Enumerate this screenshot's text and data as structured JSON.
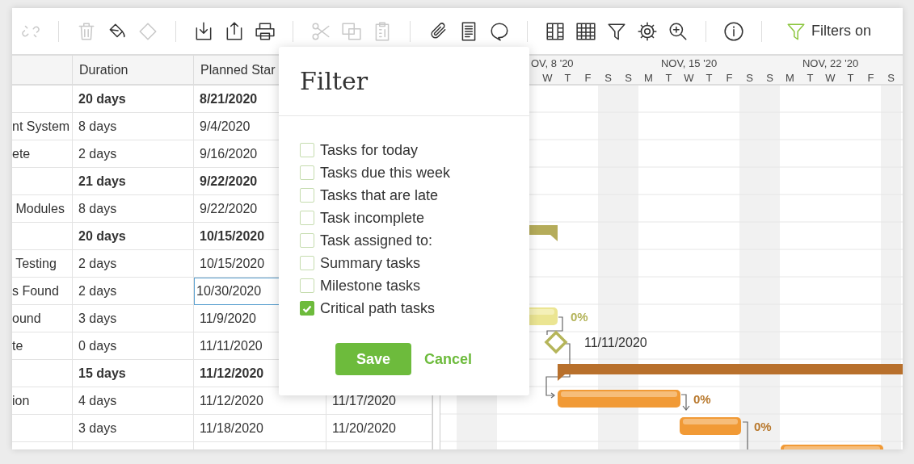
{
  "toolbar": {
    "groups": [
      {
        "items": [
          {
            "kind": "unlink",
            "disabled": true
          }
        ]
      },
      {
        "items": [
          {
            "kind": "trash",
            "disabled": true
          },
          {
            "kind": "paint-bucket",
            "disabled": false
          },
          {
            "kind": "diamond",
            "disabled": true
          }
        ]
      },
      {
        "items": [
          {
            "kind": "download",
            "disabled": false
          },
          {
            "kind": "upload",
            "disabled": false
          },
          {
            "kind": "print",
            "disabled": false
          }
        ]
      },
      {
        "items": [
          {
            "kind": "scissors",
            "disabled": true
          },
          {
            "kind": "copy",
            "disabled": true
          },
          {
            "kind": "clipboard",
            "disabled": true
          }
        ]
      },
      {
        "items": [
          {
            "kind": "paperclip",
            "disabled": false
          },
          {
            "kind": "document",
            "disabled": false
          },
          {
            "kind": "comment",
            "disabled": false
          }
        ]
      },
      {
        "items": [
          {
            "kind": "columns",
            "disabled": false
          },
          {
            "kind": "grid",
            "disabled": false
          },
          {
            "kind": "filter",
            "disabled": false
          },
          {
            "kind": "gear",
            "disabled": false
          },
          {
            "kind": "zoom-in",
            "disabled": false
          }
        ]
      },
      {
        "items": [
          {
            "kind": "info",
            "disabled": false
          }
        ]
      }
    ],
    "filter_status": {
      "label": "Filters on",
      "active": true
    }
  },
  "table": {
    "columns": [
      "Duration",
      "Planned Star"
    ],
    "rows": [
      {
        "name": "",
        "duration": "20 days",
        "start": "8/21/2020",
        "summary": true,
        "start_selected": false
      },
      {
        "name": "nt System",
        "duration": "8 days",
        "start": "9/4/2020",
        "summary": false,
        "start_selected": false
      },
      {
        "name": "ete",
        "duration": "2 days",
        "start": "9/16/2020",
        "summary": false,
        "start_selected": false
      },
      {
        "name": "",
        "duration": "21 days",
        "start": "9/22/2020",
        "summary": true,
        "start_selected": false
      },
      {
        "name": " Modules",
        "duration": "8 days",
        "start": "9/22/2020",
        "summary": false,
        "start_selected": false
      },
      {
        "name": "",
        "duration": "20 days",
        "start": "10/15/2020",
        "summary": true,
        "start_selected": false
      },
      {
        "name": " Testing",
        "duration": "2 days",
        "start": "10/15/2020",
        "summary": false,
        "start_selected": false
      },
      {
        "name": "s Found",
        "duration": "2 days",
        "start": "10/30/2020",
        "summary": false,
        "start_selected": true
      },
      {
        "name": "ound",
        "duration": "3 days",
        "start": "11/9/2020",
        "summary": false,
        "start_selected": false
      },
      {
        "name": "te",
        "duration": "0 days",
        "start": "11/11/2020",
        "summary": false,
        "start_selected": false
      },
      {
        "name": "",
        "duration": "15 days",
        "start": "11/12/2020",
        "summary": true,
        "start_selected": false
      },
      {
        "name": "ion",
        "duration": "4 days",
        "start": "11/12/2020",
        "end": "11/17/2020",
        "summary": false,
        "start_selected": false
      },
      {
        "name": "",
        "duration": "3 days",
        "start": "11/18/2020",
        "end": "11/20/2020",
        "summary": false,
        "start_selected": false
      }
    ]
  },
  "gantt": {
    "weeks": [
      {
        "label": "OV, 8 '20",
        "days": [
          "W",
          "T",
          "F",
          "S"
        ]
      },
      {
        "label": "NOV, 15 '20",
        "days": [
          "S",
          "M",
          "T",
          "W",
          "T",
          "F",
          "S"
        ]
      },
      {
        "label": "NOV, 22 '20",
        "days": [
          "S",
          "M",
          "T",
          "W",
          "T",
          "F",
          "S"
        ]
      }
    ],
    "bars": [
      {
        "kind": "summary",
        "critical": false
      },
      {
        "kind": "task",
        "critical": false,
        "label": "0%"
      },
      {
        "kind": "milestone",
        "critical": false,
        "label": "11/11/2020"
      },
      {
        "kind": "summary",
        "critical": true
      },
      {
        "kind": "task",
        "critical": true,
        "label": "0%"
      },
      {
        "kind": "task",
        "critical": true,
        "label": "0%"
      },
      {
        "kind": "task",
        "critical": true
      }
    ]
  },
  "dialog": {
    "title": "Filter",
    "options": [
      {
        "label": "Tasks for today",
        "checked": false
      },
      {
        "label": "Tasks due this week",
        "checked": false
      },
      {
        "label": "Tasks that are late",
        "checked": false
      },
      {
        "label": "Task incomplete",
        "checked": false
      },
      {
        "label": "Task assigned to:",
        "checked": false
      },
      {
        "label": "Summary tasks",
        "checked": false
      },
      {
        "label": "Milestone tasks",
        "checked": false
      },
      {
        "label": "Critical path tasks",
        "checked": true
      }
    ],
    "buttons": [
      {
        "label": "Save",
        "kind": "primary"
      },
      {
        "label": "Cancel",
        "kind": "link"
      }
    ]
  }
}
